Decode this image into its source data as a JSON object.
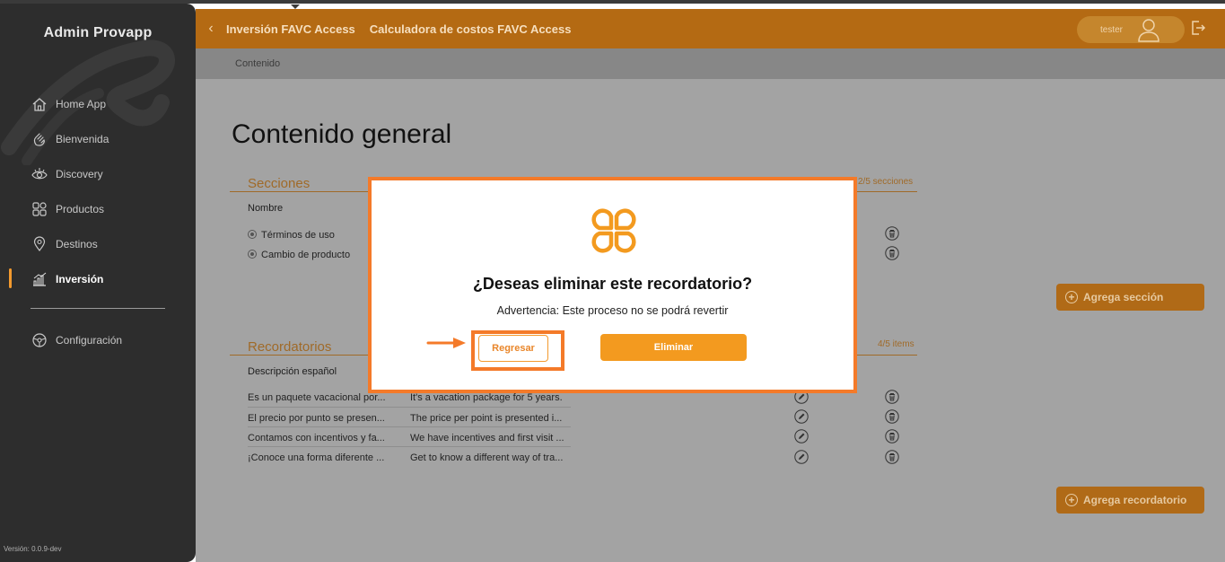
{
  "app": {
    "brand": "Admin Provapp",
    "version": "Versión: 0.0.9-dev"
  },
  "sidebar": {
    "items": [
      {
        "label": "Home App",
        "icon": "home-icon"
      },
      {
        "label": "Bienvenida",
        "icon": "waving-hand-icon"
      },
      {
        "label": "Discovery",
        "icon": "eye-icon"
      },
      {
        "label": "Productos",
        "icon": "grid-icon"
      },
      {
        "label": "Destinos",
        "icon": "location-pin-icon"
      },
      {
        "label": "Inversión",
        "icon": "bar-chart-icon",
        "active": true
      },
      {
        "label": "Configuración",
        "icon": "steering-wheel-icon"
      }
    ]
  },
  "header": {
    "breadcrumb_1": "Inversión FAVC Access",
    "breadcrumb_2": "Calculadora de costos FAVC Access",
    "user": "tester"
  },
  "subbar": {
    "label": "Contenido"
  },
  "main": {
    "title": "Contenido general",
    "secciones": {
      "title": "Secciones",
      "count": "2/5 secciones",
      "column": "Nombre",
      "rows": [
        "Términos de uso",
        "Cambio de producto"
      ],
      "add_label": "Agrega sección"
    },
    "recordatorios": {
      "title": "Recordatorios",
      "count": "4/5 items",
      "column": "Descripción español",
      "rows": [
        {
          "es": "Es un paquete vacacional por...",
          "en": "It's a vacation package for 5 years."
        },
        {
          "es": "El precio por punto se presen...",
          "en": "The price per point is presented i..."
        },
        {
          "es": "Contamos con incentivos y fa...",
          "en": "We have incentives and first visit ..."
        },
        {
          "es": "¡Conoce una forma diferente ...",
          "en": "Get to know a different way of tra..."
        }
      ],
      "add_label": "Agrega recordatorio"
    }
  },
  "modal": {
    "title": "¿Deseas eliminar este recordatorio?",
    "warning": "Advertencia: Este proceso no se podrá revertir",
    "back_label": "Regresar",
    "delete_label": "Eliminar"
  },
  "colors": {
    "accent": "#f39a1f",
    "highlight": "#f47a29",
    "header": "#b46a13",
    "sidebar": "#2d2d2d"
  }
}
